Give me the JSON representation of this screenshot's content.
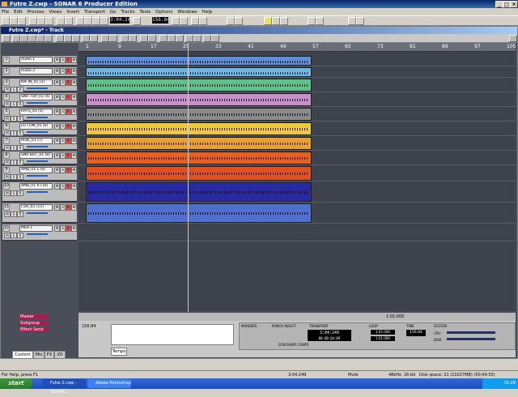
{
  "window": {
    "title": "Futre Z.cwp - SONAR 6 Producer Edition"
  },
  "menu": [
    "File",
    "Edit",
    "Process",
    "Views",
    "Insert",
    "Transport",
    "Go",
    "Tracks",
    "Tools",
    "Options",
    "Windows",
    "Help"
  ],
  "toolbar": {
    "time_display": "3:04:249",
    "tempo": "156.84"
  },
  "document": {
    "title": "Futre Z.cwp* - Track"
  },
  "ruler_marks": [
    "1",
    "9",
    "17",
    "25",
    "33",
    "41",
    "49",
    "57",
    "65",
    "73",
    "81",
    "89",
    "97",
    "105"
  ],
  "tracks": [
    {
      "num": "1",
      "name": "Audio 1"
    },
    {
      "num": "2",
      "name": "Audio 2"
    },
    {
      "num": "3",
      "name": "KIK IN_01 (3)"
    },
    {
      "num": "4",
      "name": "SNR TOP_01 (4)"
    },
    {
      "num": "5",
      "name": "HATS_01 (5)"
    },
    {
      "num": "6",
      "name": "LO TOM_01 (6)"
    },
    {
      "num": "7",
      "name": "RIDE_01 (7)"
    },
    {
      "num": "8",
      "name": "SNR BOT_01 (8)"
    },
    {
      "num": "9",
      "name": "AMB_01 L (9)"
    },
    {
      "num": "10",
      "name": "AMB_01 R (10)"
    },
    {
      "num": "11",
      "name": "CSH_01 (11)"
    },
    {
      "num": "12",
      "name": "MIDI 1"
    }
  ],
  "buses": [
    "Master",
    "Subgroup",
    "Effect Send"
  ],
  "view_tabs": [
    "Custom",
    "Mix",
    "FX",
    "I/O"
  ],
  "bottom": {
    "tab": "Tempo",
    "tempo_value": "156.84",
    "tempo_time": "1:01:000",
    "marker_label": "MARKERS",
    "punch_label": "PUNCH IN/OUT",
    "transport_label": "TRANSPORT",
    "loop_label": "LOOP",
    "time_label": "TIME",
    "transport_time": "3:04:249",
    "smpte": "00:00:04:09",
    "sync_label": "SYNCH/WR COMPS",
    "loop_start": "1:01:000",
    "loop_end": "1:01:000",
    "tempo_display": "156.84",
    "cpu_label": "CPU",
    "disk_label": "DISK",
    "system_label": "SYSTEM"
  },
  "status": {
    "help": "For Help, press F1",
    "time": "3:04:249",
    "mode": "Mute",
    "format": "48kHz, 16-bit",
    "disk": "Disk space: 21 (21027MB) (50:04:55)"
  },
  "taskbar": {
    "start": "start",
    "tasks": [
      "Futre Z.cwp - SONAR...",
      "Adobe Photoshop"
    ],
    "clock": "15:29"
  },
  "colors": {
    "lane_colors": [
      "#5f8fd8",
      "#6ab8e8",
      "#5ec08a",
      "#c890c8",
      "#8a8a8a",
      "#f0c840",
      "#e8a030",
      "#e86020",
      "#e05020",
      "#2a2aa0",
      "#5070d0"
    ]
  }
}
